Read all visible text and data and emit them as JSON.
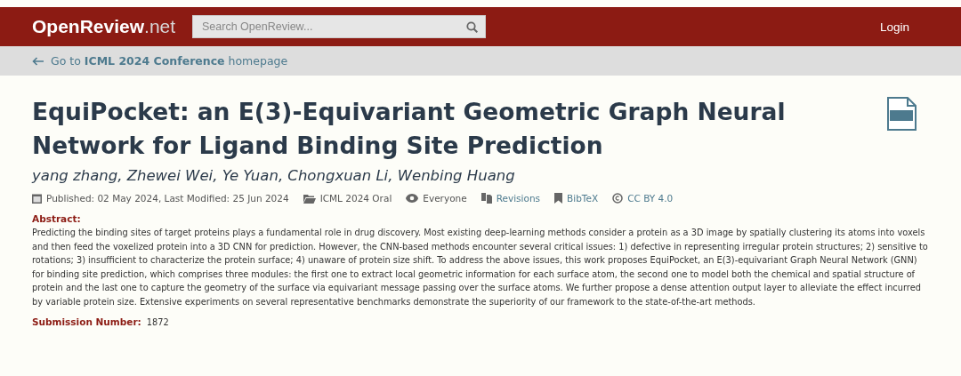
{
  "header": {
    "logo_main": "OpenReview",
    "logo_suffix": ".net",
    "search": {
      "placeholder": "Search OpenReview..."
    },
    "login": "Login"
  },
  "breadcrumb": {
    "text": "Go to **ICML 2024 Conference** homepage"
  },
  "paper": {
    "title": "EquiPocket: an E(3)-Equivariant Geometric Graph Neural Network for Ligand Binding Site Prediction",
    "authors": "yang zhang, Zhewei Wei, Ye Yuan, Chongxuan Li, Wenbing Huang",
    "meta": [
      {
        "kind": "date",
        "text": "Published: 02 May 2024, Last Modified: 25 Jun 2024",
        "link": false
      },
      {
        "kind": "venue",
        "text": "ICML 2024 Oral",
        "link": false
      },
      {
        "kind": "readers",
        "text": "Everyone",
        "link": false
      },
      {
        "kind": "revisions",
        "text": "Revisions",
        "link": true
      },
      {
        "kind": "bibtex",
        "text": "BibTeX",
        "link": true
      },
      {
        "kind": "license",
        "text": "CC BY 4.0",
        "link": true
      }
    ],
    "fields": [
      {
        "label": "Abstract:",
        "value": "Predicting the binding sites of target proteins plays a fundamental role in drug discovery. Most existing deep-learning methods consider a protein as a 3D image by spatially clustering its atoms into voxels and then feed the voxelized protein into a 3D CNN for prediction. However, the CNN-based methods encounter several critical issues: 1) defective in representing irregular protein structures; 2) sensitive to rotations; 3) insufficient to characterize the protein surface; 4) unaware of protein size shift. To address the above issues, this work proposes EquiPocket, an E(3)-equivariant Graph Neural Network (GNN) for binding site prediction, which comprises three modules: the first one to extract local geometric information for each surface atom, the second one to model both the chemical and spatial structure of protein and the last one to capture the geometry of the surface via equivariant message passing over the surface atoms. We further propose a dense attention output layer to alleviate the effect incurred by variable protein size. Extensive experiments on several representative benchmarks demonstrate the superiority of our framework to the state-of-the-art methods.",
        "kind": "block"
      },
      {
        "label": "Submission Number:",
        "value": "1872",
        "kind": "inline"
      }
    ]
  }
}
